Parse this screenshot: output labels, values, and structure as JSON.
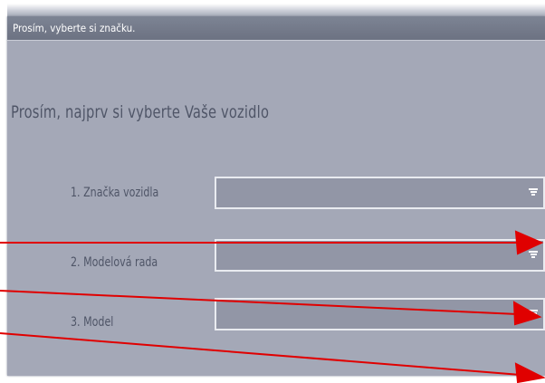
{
  "window": {
    "title": "Prosím, vyberte si značku."
  },
  "heading": "Prosím, najprv si vyberte Vaše vozidlo",
  "fields": [
    {
      "label": "1. Značka vozidla",
      "value": ""
    },
    {
      "label": "2. Modelová rada",
      "value": ""
    },
    {
      "label": "3. Model",
      "value": ""
    }
  ],
  "colors": {
    "window_bg": "#a4a8b7",
    "title_bar": "#747a8a",
    "field_bg": "#9296a6",
    "text": "#4f5567",
    "annotation": "#e00000"
  },
  "icons": {
    "dropdown": "filter-lines-icon",
    "annotation": "red-arrow"
  }
}
